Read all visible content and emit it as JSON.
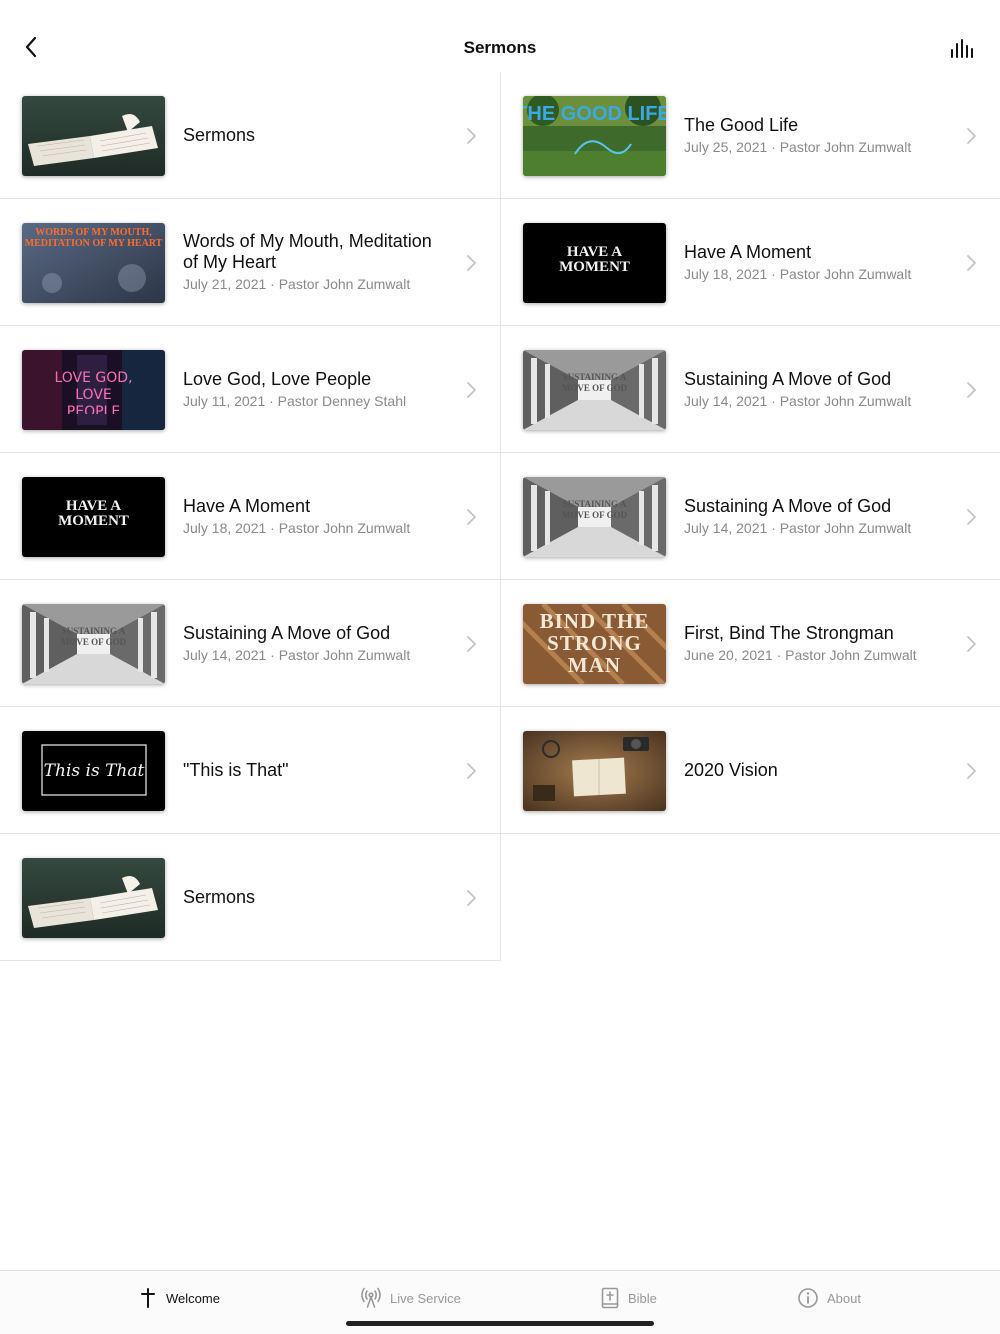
{
  "header": {
    "title": "Sermons"
  },
  "items": [
    {
      "title": "Sermons",
      "meta": "",
      "thumb": "open-bible-photo"
    },
    {
      "title": "The Good Life",
      "meta": "July 25, 2021 · Pastor John Zumwalt",
      "thumb": "the-good-life-graphic",
      "thumb_text": "THE GOOD LIFE"
    },
    {
      "title": "Words of My Mouth, Meditation of My Heart",
      "meta": "July 21, 2021 · Pastor John Zumwalt",
      "thumb": "words-of-my-mouth-graphic",
      "thumb_text": "WORDS OF MY MOUTH, MEDITATION OF MY HEART"
    },
    {
      "title": "Have A Moment",
      "meta": "July 18, 2021 · Pastor John Zumwalt",
      "thumb": "have-a-moment-graphic",
      "thumb_text": "HAVE A MOMENT"
    },
    {
      "title": "Love God, Love People",
      "meta": "July 11, 2021 · Pastor Denney Stahl",
      "thumb": "love-god-love-people-graphic",
      "thumb_text": "LOVE GOD, LOVE PEOPLE"
    },
    {
      "title": "Sustaining A Move of God",
      "meta": "July 14, 2021 · Pastor John Zumwalt",
      "thumb": "sustaining-move-graphic",
      "thumb_text": "SUSTAINING A MOVE OF GOD"
    },
    {
      "title": "Have A Moment",
      "meta": "July 18, 2021 · Pastor John Zumwalt",
      "thumb": "have-a-moment-graphic",
      "thumb_text": "HAVE A MOMENT"
    },
    {
      "title": "Sustaining A Move of God",
      "meta": "July 14, 2021 · Pastor John Zumwalt",
      "thumb": "sustaining-move-graphic",
      "thumb_text": "SUSTAINING A MOVE OF GOD"
    },
    {
      "title": "Sustaining A Move of God",
      "meta": "July 14, 2021 · Pastor John Zumwalt",
      "thumb": "sustaining-move-graphic",
      "thumb_text": "SUSTAINING A MOVE OF GOD"
    },
    {
      "title": "First, Bind The Strongman",
      "meta": "June 20, 2021 · Pastor John Zumwalt",
      "thumb": "bind-the-strongman-graphic",
      "thumb_text": "BIND THE STRONG MAN"
    },
    {
      "title": "\"This is That\"",
      "meta": "",
      "thumb": "this-is-that-graphic",
      "thumb_text": "This is That"
    },
    {
      "title": "2020 Vision",
      "meta": "",
      "thumb": "desk-notebook-photo"
    },
    {
      "title": "Sermons",
      "meta": "",
      "thumb": "open-bible-photo"
    }
  ],
  "tabbar": {
    "tabs": [
      {
        "label": "Welcome",
        "icon": "cross-icon",
        "active": true
      },
      {
        "label": "Live Service",
        "icon": "broadcast-icon",
        "active": false
      },
      {
        "label": "Bible",
        "icon": "bible-icon",
        "active": false
      },
      {
        "label": "About",
        "icon": "info-icon",
        "active": false
      }
    ]
  },
  "colors": {
    "divider": "#e4e4e4",
    "meta_text": "#8a8a8a",
    "inactive_tab": "#999999"
  }
}
